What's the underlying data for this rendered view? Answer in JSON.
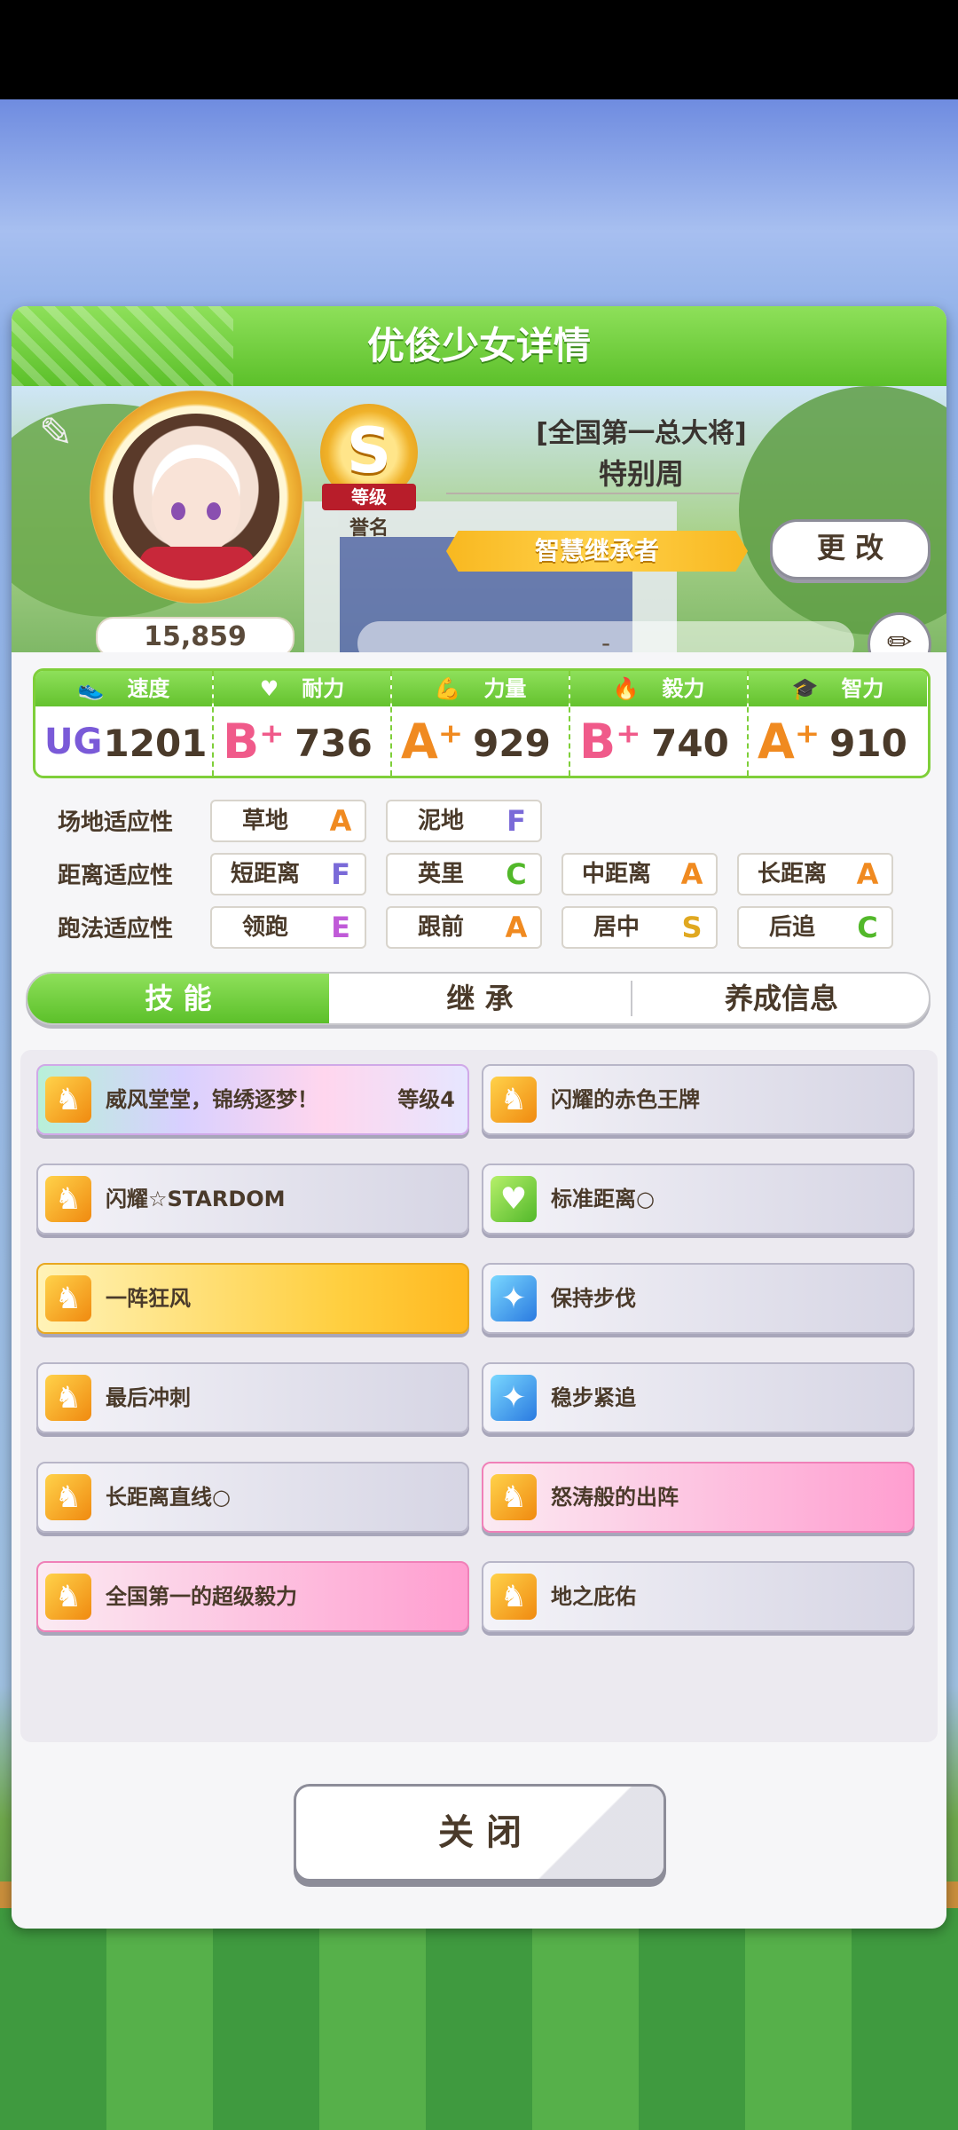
{
  "header": {
    "title": "优俊少女详情"
  },
  "profile": {
    "fans": "15,859",
    "rank": {
      "letter": "S",
      "ribbon": "等级",
      "label": "誉名"
    },
    "title": "[全国第一总大将]",
    "name": "特别周",
    "epithet": "智慧继承者",
    "change_label": "更 改",
    "memo": "-",
    "icons": {
      "carrot": "carrot-icon",
      "edit": "pencil-icon"
    }
  },
  "stats": [
    {
      "label": "速度",
      "icon": "shoe-icon",
      "grade": "UG",
      "value": "1201",
      "color": "#7a5ad8"
    },
    {
      "label": "耐力",
      "icon": "heart-icon",
      "grade": "B⁺",
      "value": "736",
      "color": "#f05a8a"
    },
    {
      "label": "力量",
      "icon": "muscle-icon",
      "grade": "A⁺",
      "value": "929",
      "color": "#f08a20"
    },
    {
      "label": "毅力",
      "icon": "flame-icon",
      "grade": "B⁺",
      "value": "740",
      "color": "#f05a8a"
    },
    {
      "label": "智力",
      "icon": "graduation-cap-icon",
      "grade": "A⁺",
      "value": "910",
      "color": "#f08a20"
    }
  ],
  "aptitudes": {
    "track": {
      "label": "场地适应性",
      "items": [
        {
          "name": "草地",
          "grade": "A"
        },
        {
          "name": "泥地",
          "grade": "F"
        }
      ]
    },
    "distance": {
      "label": "距离适应性",
      "items": [
        {
          "name": "短距离",
          "grade": "F"
        },
        {
          "name": "英里",
          "grade": "C"
        },
        {
          "name": "中距离",
          "grade": "A"
        },
        {
          "name": "长距离",
          "grade": "A"
        }
      ]
    },
    "style": {
      "label": "跑法适应性",
      "items": [
        {
          "name": "领跑",
          "grade": "E"
        },
        {
          "name": "跟前",
          "grade": "A"
        },
        {
          "name": "居中",
          "grade": "S"
        },
        {
          "name": "后追",
          "grade": "C"
        }
      ]
    }
  },
  "tabs": [
    {
      "label": "技 能"
    },
    {
      "label": "继 承"
    },
    {
      "label": "养成信息"
    }
  ],
  "skills": [
    {
      "name": "威风堂堂，锦绣逐梦！",
      "level": "等级4",
      "style": "rainbow",
      "icon": "running-horse-icon"
    },
    {
      "name": "闪耀的赤色王牌",
      "style": "gray",
      "icon": "running-horse-icon"
    },
    {
      "name": "闪耀☆STARDOM",
      "style": "gray",
      "icon": "running-horse-icon"
    },
    {
      "name": "标准距离○",
      "style": "gray",
      "icon": "heart-icon"
    },
    {
      "name": "一阵狂风",
      "style": "gold",
      "icon": "running-horse-icon"
    },
    {
      "name": "保持步伐",
      "style": "gray",
      "icon": "sparkle-icon"
    },
    {
      "name": "最后冲刺",
      "style": "gray",
      "icon": "running-horse-icon"
    },
    {
      "name": "稳步紧追",
      "style": "gray",
      "icon": "sparkle-icon"
    },
    {
      "name": "长距离直线○",
      "style": "gray",
      "icon": "running-horse-icon"
    },
    {
      "name": "怒涛般的出阵",
      "style": "pink",
      "icon": "running-horse-icon"
    },
    {
      "name": "全国第一的超级毅力",
      "style": "pink",
      "icon": "running-horse-icon"
    },
    {
      "name": "地之庇佑",
      "style": "gray",
      "icon": "running-horse-icon"
    }
  ],
  "close_label": "关 闭"
}
